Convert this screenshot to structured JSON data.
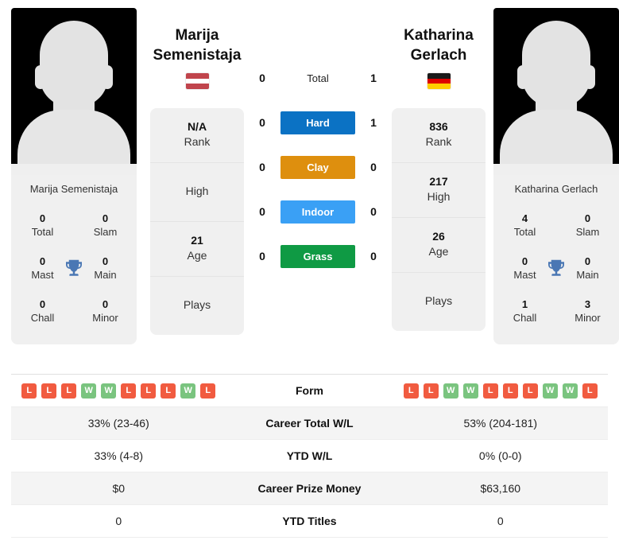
{
  "players": {
    "left": {
      "name_line1": "Marija",
      "name_line2": "Semenistaja",
      "full_name": "Marija Semenistaja",
      "country": "Latvia",
      "flag_colors": [
        "#c0444c",
        "#ffffff",
        "#c0444c"
      ],
      "info": {
        "rank_value": "N/A",
        "rank_label": "Rank",
        "high_value": "",
        "high_label": "High",
        "age_value": "21",
        "age_label": "Age",
        "plays_value": "",
        "plays_label": "Plays"
      },
      "titles": {
        "total_value": "0",
        "total_label": "Total",
        "slam_value": "0",
        "slam_label": "Slam",
        "mast_value": "0",
        "mast_label": "Mast",
        "main_value": "0",
        "main_label": "Main",
        "chall_value": "0",
        "chall_label": "Chall",
        "minor_value": "0",
        "minor_label": "Minor"
      },
      "form": [
        "L",
        "L",
        "L",
        "W",
        "W",
        "L",
        "L",
        "L",
        "W",
        "L"
      ],
      "stats": {
        "career_wl": "33% (23-46)",
        "ytd_wl": "33% (4-8)",
        "prize_money": "$0",
        "ytd_titles": "0"
      }
    },
    "right": {
      "name_line1": "Katharina",
      "name_line2": "Gerlach",
      "full_name": "Katharina Gerlach",
      "country": "Germany",
      "flag_colors": [
        "#1a1a1a",
        "#dd0000",
        "#ffcc00"
      ],
      "info": {
        "rank_value": "836",
        "rank_label": "Rank",
        "high_value": "217",
        "high_label": "High",
        "age_value": "26",
        "age_label": "Age",
        "plays_value": "",
        "plays_label": "Plays"
      },
      "titles": {
        "total_value": "4",
        "total_label": "Total",
        "slam_value": "0",
        "slam_label": "Slam",
        "mast_value": "0",
        "mast_label": "Mast",
        "main_value": "0",
        "main_label": "Main",
        "chall_value": "1",
        "chall_label": "Chall",
        "minor_value": "3",
        "minor_label": "Minor"
      },
      "form": [
        "L",
        "L",
        "W",
        "W",
        "L",
        "L",
        "L",
        "W",
        "W",
        "L"
      ],
      "stats": {
        "career_wl": "53% (204-181)",
        "ytd_wl": "0% (0-0)",
        "prize_money": "$63,160",
        "ytd_titles": "0"
      }
    }
  },
  "head_to_head": [
    {
      "label": "Total",
      "left": "0",
      "right": "1",
      "badge": false,
      "color": ""
    },
    {
      "label": "Hard",
      "left": "0",
      "right": "1",
      "badge": true,
      "color": "#0b72c4"
    },
    {
      "label": "Clay",
      "left": "0",
      "right": "0",
      "badge": true,
      "color": "#de8f0e"
    },
    {
      "label": "Indoor",
      "left": "0",
      "right": "0",
      "badge": true,
      "color": "#3aa0f5"
    },
    {
      "label": "Grass",
      "left": "0",
      "right": "0",
      "badge": true,
      "color": "#0f9a44"
    }
  ],
  "stats_table": {
    "rows": [
      {
        "label": "Form",
        "type": "form"
      },
      {
        "label": "Career Total W/L",
        "type": "text",
        "key": "career_wl"
      },
      {
        "label": "YTD W/L",
        "type": "text",
        "key": "ytd_wl"
      },
      {
        "label": "Career Prize Money",
        "type": "text",
        "key": "prize_money"
      },
      {
        "label": "YTD Titles",
        "type": "text",
        "key": "ytd_titles"
      }
    ]
  },
  "icons": {
    "trophy": "trophy-icon",
    "avatar": "player-photo-placeholder"
  },
  "colors": {
    "card_bg": "#f0f0f0",
    "win": "#7ac47f",
    "loss": "#f15b40"
  }
}
